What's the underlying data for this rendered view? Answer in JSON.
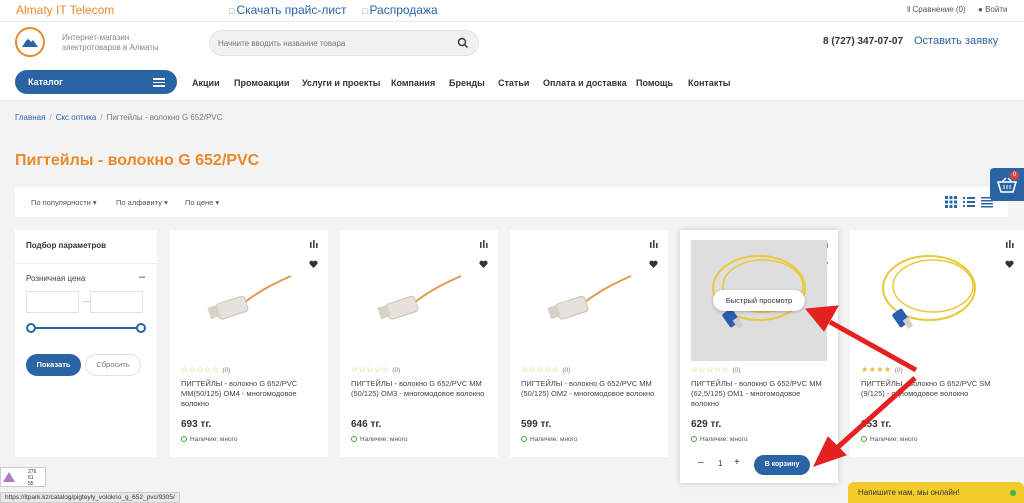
{
  "topbar": {
    "brand": "Almaty IT Telecom",
    "price_list": "Скачать прайс-лист",
    "sale": "Распродажа",
    "compare": "Сравнение (0)",
    "login": "Войти"
  },
  "header": {
    "tagline": "Интернет-магазин электротоваров в Алматы",
    "search_placeholder": "Начните вводить название товара",
    "phone": "8 (727) 347-07-07",
    "order_link": "Оставить заявку"
  },
  "nav": {
    "catalog": "Каталог",
    "items": [
      "Акции",
      "Промоакции",
      "Услуги и проекты",
      "Компания",
      "Бренды",
      "Статьи",
      "Оплата и доставка",
      "Помощь",
      "Контакты"
    ]
  },
  "breadcrumbs": [
    "Главная",
    "Скс оптика",
    "Пигтейлы - волокно G 652/PVC"
  ],
  "page_title": "Пигтейлы - волокно G 652/PVC",
  "sort": {
    "items": [
      "По популярности",
      "По алфавиту",
      "По цене"
    ]
  },
  "filter": {
    "title": "Подбор параметров",
    "price_label": "Розничная цена",
    "show": "Показать",
    "reset": "Сбросить"
  },
  "products": [
    {
      "name": "ПИГТЕЙЛЫ - волокно G 652/PVC MM(50/125) OM4 - многомодовое волокно",
      "price": "693 тг.",
      "stock": "Наличие: много",
      "rating_count": "(0)",
      "color": "#e39a4e"
    },
    {
      "name": "ПИГТЕЙЛЫ - волокно G 652/PVC MM (50/125) OM3 - многомодовое волокно",
      "price": "646 тг.",
      "stock": "Наличие: много",
      "rating_count": "(0)",
      "color": "#e39a4e"
    },
    {
      "name": "ПИГТЕЙЛЫ - волокно G 652/PVC MM (50/125) OM2 - многомодовое волокно",
      "price": "599 тг.",
      "stock": "Наличие: много",
      "rating_count": "(0)",
      "color": "#e39a4e"
    },
    {
      "name": "ПИГТЕЙЛЫ - волокно G 652/PVC MM (62,5/125) OM1 - многомодовое волокно",
      "price": "629 тг.",
      "stock": "Наличие: много",
      "rating_count": "(0)",
      "color": "#e9c93a"
    },
    {
      "name": "ПИГТЕЙЛЫ - волокно G 652/PVC SM (9/125) - одномодовое волокно",
      "price": "653 тг.",
      "stock": "Наличие: много",
      "rating_count": "(0)",
      "color": "#e9c93a"
    }
  ],
  "hover_card": {
    "quick_view": "Быстрый просмотр",
    "qty": "1",
    "add_to_cart": "В корзину"
  },
  "basket_count": "0",
  "chat": "Напишите нам, мы онлайн!",
  "status_url": "https://itpark.kz/catalog/pigteyly_volokno_g_652_pvc/9305/",
  "stats": [
    "276",
    "61",
    "55"
  ],
  "colors": {
    "accent": "#e8892b",
    "primary": "#2a64a5",
    "arrow": "#e52020"
  }
}
